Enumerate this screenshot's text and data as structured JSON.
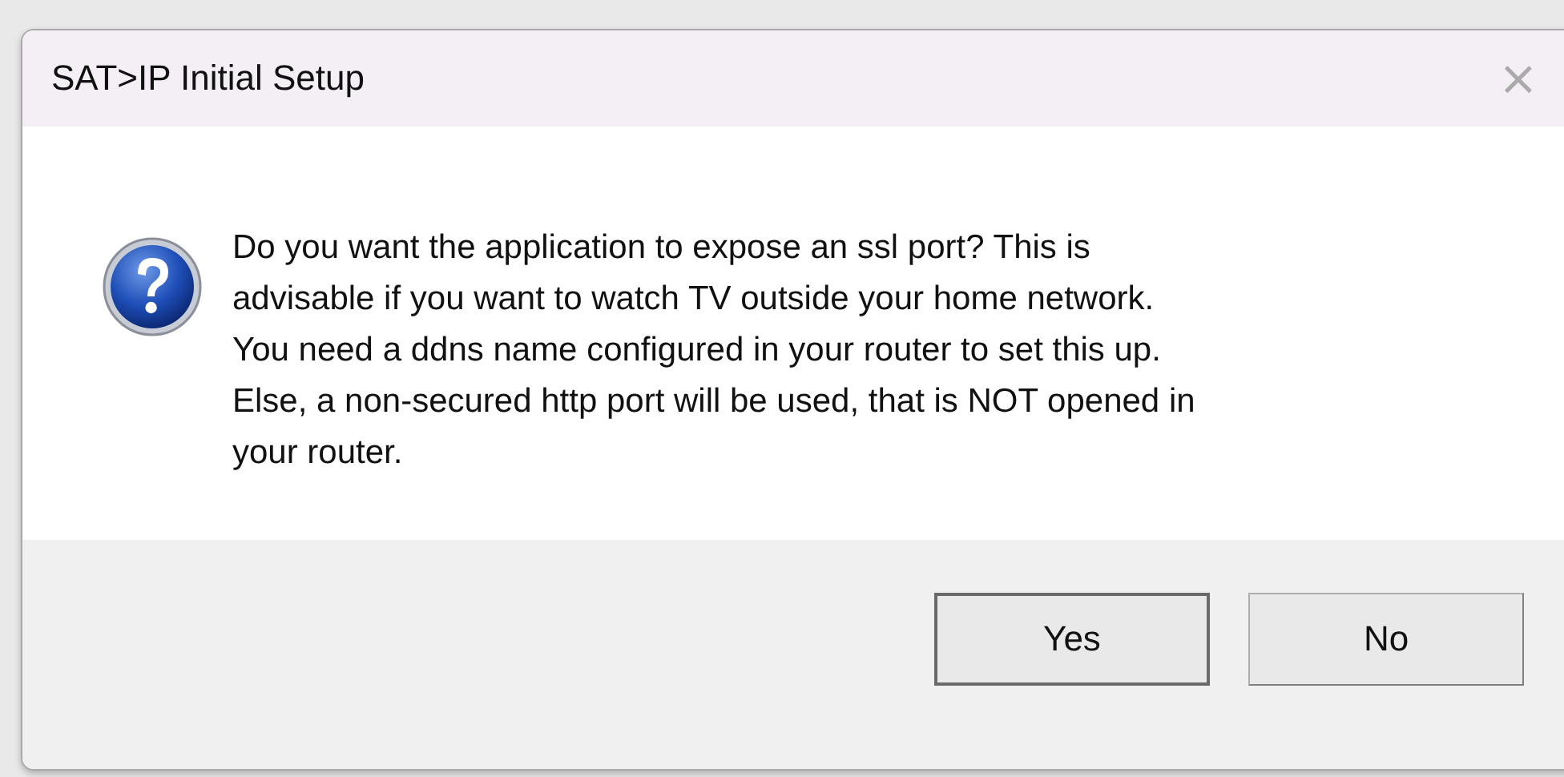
{
  "window": {
    "title": "SAT>IP Initial Setup",
    "close": "×"
  },
  "message": {
    "lines": [
      "Do you want the application to expose an ssl port? This is",
      "advisable if you want to watch TV outside your home network.",
      "You need a ddns name configured in your router to set this up.",
      "Else, a non-secured http port will be used, that is NOT opened in",
      "your router."
    ]
  },
  "buttons": [
    {
      "label": "Yes",
      "default": true
    },
    {
      "label": "No",
      "default": false
    }
  ]
}
